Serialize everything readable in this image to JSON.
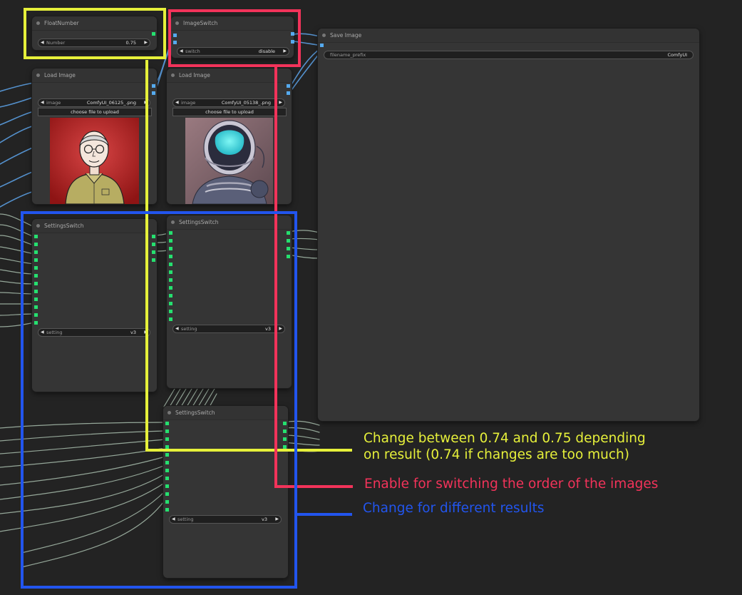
{
  "nodes": {
    "float_number": {
      "title": "FloatNumber",
      "widget": {
        "name": "Number",
        "value": "0.75"
      }
    },
    "image_switch": {
      "title": "ImageSwitch",
      "widget": {
        "name": "switch",
        "value": "disable"
      }
    },
    "save_image": {
      "title": "Save Image",
      "widget": {
        "name": "filename_prefix",
        "value": "ComfyUI"
      }
    },
    "load_image_1": {
      "title": "Load Image",
      "widget": {
        "name": "image",
        "value": "ComfyUI_06125_.png"
      },
      "upload_label": "choose file to upload"
    },
    "load_image_2": {
      "title": "Load Image",
      "widget": {
        "name": "image",
        "value": "ComfyUI_05138_.png"
      },
      "upload_label": "choose file to upload"
    },
    "settings_switch_1": {
      "title": "SettingsSwitch",
      "widget": {
        "name": "setting",
        "value": "v3"
      }
    },
    "settings_switch_2": {
      "title": "SettingsSwitch",
      "widget": {
        "name": "setting",
        "value": "v3"
      }
    },
    "settings_switch_3": {
      "title": "SettingsSwitch",
      "widget": {
        "name": "setting",
        "value": "v3"
      }
    }
  },
  "annotations": {
    "yellow": {
      "line1": "Change between 0.74 and 0.75 depending",
      "line2": "on result (0.74 if changes are too much)",
      "color": "#e6f03a"
    },
    "red": {
      "text": "Enable for switching the order of the images",
      "color": "#f2335a"
    },
    "blue": {
      "text": "Change for different results",
      "color": "#2255ee"
    }
  },
  "colors": {
    "canvas": "#232323",
    "node": "#353535",
    "port_green": "#25e06f",
    "port_blue": "#55aaee",
    "wire_blue": "#5a9de0",
    "wire_pale": "#a9bfae"
  }
}
